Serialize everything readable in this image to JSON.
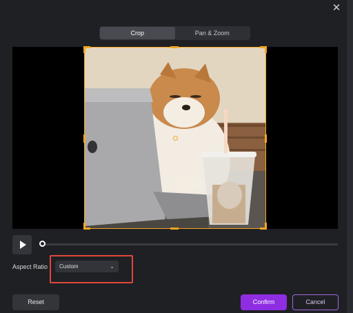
{
  "dialog": {
    "close_icon": "close-icon"
  },
  "tabs": [
    {
      "label": "Crop",
      "active": true
    },
    {
      "label": "Pan & Zoom",
      "active": false
    }
  ],
  "player": {
    "play_icon": "play-icon",
    "progress": 0
  },
  "aspect": {
    "label": "Aspect Ratio",
    "value": "Custom"
  },
  "footer": {
    "reset_label": "Reset",
    "confirm_label": "Confirm",
    "cancel_label": "Cancel"
  },
  "colors": {
    "accent": "#8e2de2",
    "crop_frame": "#f5a623",
    "highlight": "#e2473a"
  }
}
